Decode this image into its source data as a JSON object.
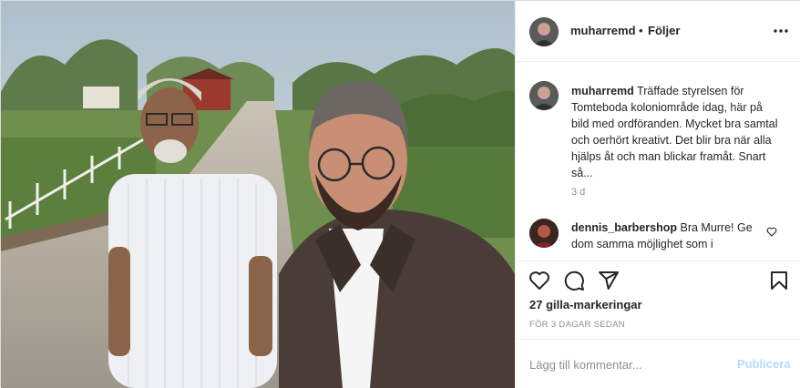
{
  "post": {
    "username": "muharremd",
    "separator": "•",
    "follow_label": "Följer",
    "caption_username": "muharremd",
    "caption_text": "Träffade styrelsen för Tomteboda koloniområde idag, här på bild med ordföranden. Mycket bra samtal och oerhört kreativt. Det blir bra när alla hjälps åt och man blickar framåt. Snart så...",
    "caption_age": "3 d",
    "comment": {
      "username": "dennis_barbershop",
      "text": "Bra Murre! Ge dom samma möjlighet som i"
    },
    "likes": "27 gilla-markeringar",
    "timestamp": "FÖR 3 DAGAR SEDAN",
    "add_comment_placeholder": "Lägg till kommentar...",
    "publish_label": "Publicera"
  },
  "icons": {
    "more": "more-options-icon",
    "like": "heart-icon",
    "comment": "comment-icon",
    "share": "share-icon",
    "save": "bookmark-icon"
  },
  "colors": {
    "text": "#262626",
    "muted": "#8e8e8e",
    "publish_disabled": "#b3dbff",
    "border": "#efefef"
  }
}
